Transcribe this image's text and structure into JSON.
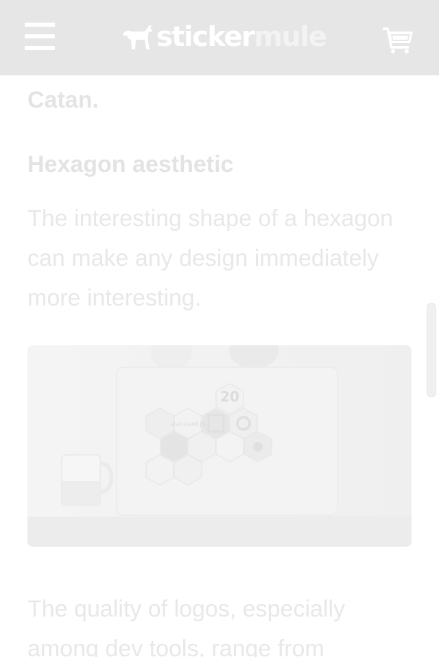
{
  "header": {
    "logo_primary": "sticker",
    "logo_secondary": "mule",
    "background": "#e6e6e6"
  },
  "icons": {
    "menu": "hamburger-menu-icon",
    "logo_mark": "mule-logo-icon",
    "cart": "shopping-cart-icon"
  },
  "article": {
    "previous_text": "Catan.",
    "section_heading": "Hexagon aesthetic",
    "paragraph_1": "The interesting shape of a hexagon can make any design immediately more interesting.",
    "photo": {
      "stickers": [
        "20",
        "standard JS"
      ]
    },
    "paragraph_2": "The quality of logos, especially among dev tools, range from"
  }
}
